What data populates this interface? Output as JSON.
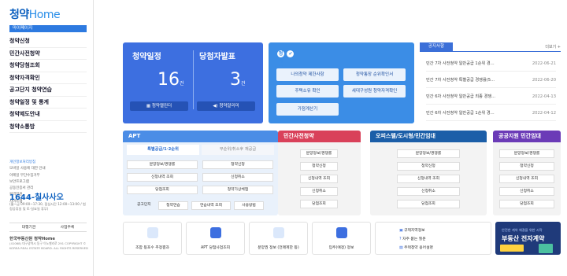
{
  "sidebar": {
    "logo_prefix": "청약",
    "logo_suffix": "Home",
    "mypage": "마이페이지",
    "menu": [
      "청약신청",
      "민간사전청약",
      "청약당첨조회",
      "청약자격확인",
      "공고단지 청약연습",
      "청약일정 및 통계",
      "청약제도안내",
      "청약소통방"
    ],
    "links": [
      "개인정보처리방침",
      "모바일 사용에 대한 안내",
      "이메일 무단수집거부",
      "보안프로그램",
      "공동인증서 관리",
      "원격지원",
      "사이트맵"
    ],
    "phone": "1644-칠사사오",
    "hours": "(월~금 09:00~17:30, 점심시간 12:00~13:00 / 법정공휴일 및 토·일요일 휴무)",
    "buttons": [
      "대행기관",
      "사업주체"
    ],
    "footer_logo": "한국부동산원 청약Home",
    "footer_text": "(41068) 대구광역시 동구 이노밸리로 291 COPYRIGHT © KOREA REAL ESTATE BOARD. ALL RIGHTS RESERVED"
  },
  "schedule": {
    "title_left": "청약일정",
    "title_right": "당첨자발표",
    "count_left": "16",
    "count_right": "3",
    "unit": "건",
    "btn_left": "청약캘린더",
    "btn_right": "청약알리미"
  },
  "qualification": {
    "title": "청약자격확인",
    "buttons": [
      "나의청약 제한사항",
      "청약통장 순위확인서",
      "주택소유 확인",
      "세대구성원 청약자격확인",
      "가점계산기"
    ]
  },
  "notice": {
    "tab": "공지사항",
    "more": "더보기",
    "items": [
      {
        "title": "민간 7차 사전청약 일반공급 1순위 경...",
        "date": "2022-06-21"
      },
      {
        "title": "민간 7차 사전청약 특별공급 경쟁률(5...",
        "date": "2022-06-20"
      },
      {
        "title": "민간 6차 사전청약 일반공급 최종 경쟁...",
        "date": "2022-04-13"
      },
      {
        "title": "민간 6차 사전청약 일반공급 1순위 경...",
        "date": "2022-04-12"
      }
    ]
  },
  "apt": {
    "title": "APT",
    "tab_active": "특별공급/1·2순위",
    "tab_inactive": "무순위/취소후 재공급",
    "buttons": [
      "분양정보/경쟁률",
      "청약신청",
      "신청내역 조회",
      "신청취소",
      "당첨조회",
      "청약가상체험"
    ],
    "practice_label": "공고단지",
    "practice": [
      "청약연습",
      "연습내역 조회",
      "사용방법"
    ]
  },
  "presale": {
    "title": "민간사전청약",
    "buttons": [
      "분양정보/경쟁률",
      "청약신청",
      "신청내역 조회",
      "신청취소",
      "당첨조회"
    ]
  },
  "officetel": {
    "title": "오피스텔/도시형/민간임대",
    "buttons": [
      "분양정보/경쟁률",
      "청약신청",
      "신청내역 조회",
      "신청취소",
      "당첨조회"
    ]
  },
  "public": {
    "title": "공공지원 민간임대",
    "buttons": [
      "분양정보/경쟁률",
      "청약신청",
      "신청내역 조회",
      "신청취소",
      "당첨조회"
    ]
  },
  "quick": [
    "조합 등포수 추정결과",
    "APT 당첨사업조회",
    "분양권 정보 (전매제한 등)",
    "입주(예정) 정보"
  ],
  "faq": [
    "규제지역정보",
    "자주 묻는 질문",
    "주택청약 용어설명"
  ],
  "banner": {
    "top": "안전한 계약 체결을 위한 시작",
    "main": "부동산 전자계약"
  },
  "colors": {
    "primary": "#3d6fe0",
    "sky": "#3b8de6",
    "presale": "#d9415a",
    "officetel": "#1b5ea8",
    "public": "#6b3bb7"
  }
}
